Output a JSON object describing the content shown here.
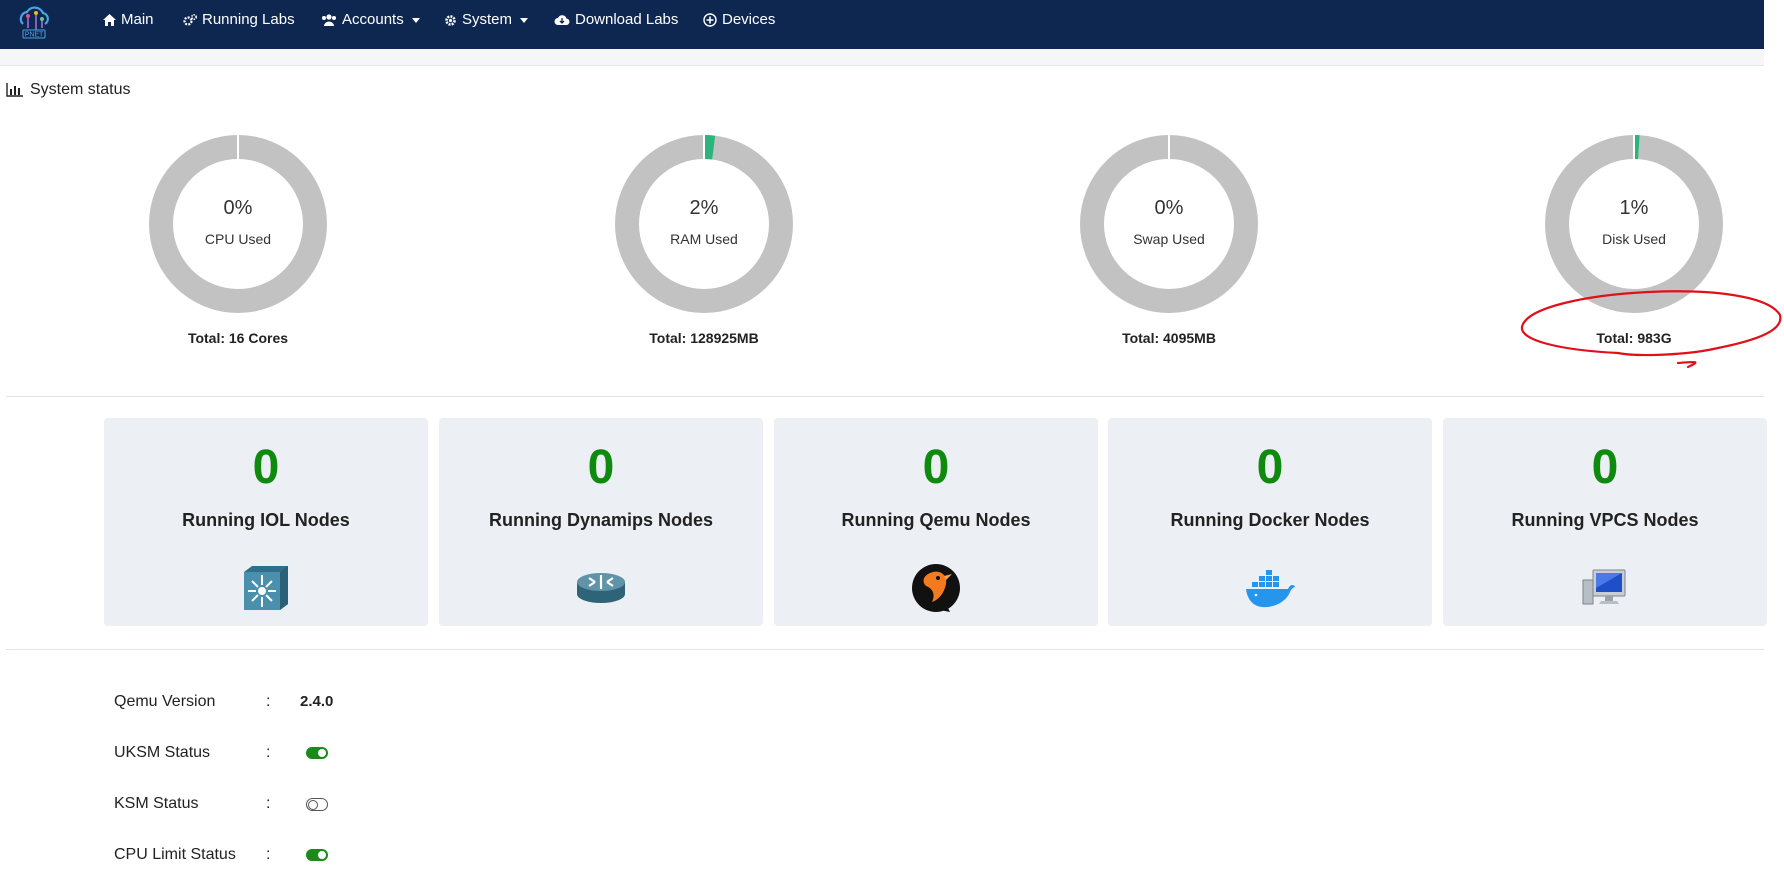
{
  "nav": {
    "logo_text": "PNET",
    "items": [
      {
        "label": "Main",
        "icon": "home-icon"
      },
      {
        "label": "Running Labs",
        "icon": "cogs-icon"
      },
      {
        "label": "Accounts",
        "icon": "users-icon",
        "dropdown": true
      },
      {
        "label": "System",
        "icon": "gear-icon",
        "dropdown": true
      },
      {
        "label": "Download Labs",
        "icon": "cloud-download-icon"
      },
      {
        "label": "Devices",
        "icon": "plus-circle-icon"
      }
    ]
  },
  "system_status": {
    "title": "System status",
    "gauges": [
      {
        "percent_text": "0%",
        "label": "CPU Used",
        "total": "Total: 16 Cores",
        "value": 0
      },
      {
        "percent_text": "2%",
        "label": "RAM Used",
        "total": "Total: 128925MB",
        "value": 2
      },
      {
        "percent_text": "0%",
        "label": "Swap Used",
        "total": "Total: 4095MB",
        "value": 0
      },
      {
        "percent_text": "1%",
        "label": "Disk Used",
        "total": "Total: 983G",
        "value": 1
      }
    ],
    "gauge_colors": {
      "track": "#c2c2c2",
      "fill": "#2bb57c"
    }
  },
  "nodes": [
    {
      "count": "0",
      "label": "Running IOL Nodes",
      "icon": "switch-icon"
    },
    {
      "count": "0",
      "label": "Running Dynamips Nodes",
      "icon": "router-icon"
    },
    {
      "count": "0",
      "label": "Running Qemu Nodes",
      "icon": "qemu-icon"
    },
    {
      "count": "0",
      "label": "Running Docker Nodes",
      "icon": "docker-icon"
    },
    {
      "count": "0",
      "label": "Running VPCS Nodes",
      "icon": "computer-icon"
    }
  ],
  "info": {
    "qemu_version": {
      "label": "Qemu Version",
      "colon": ":",
      "value": "2.4.0"
    },
    "uksm": {
      "label": "UKSM Status",
      "colon": ":",
      "enabled": true
    },
    "ksm": {
      "label": "KSM Status",
      "colon": ":",
      "enabled": false
    },
    "cpu_limit": {
      "label": "CPU Limit Status",
      "colon": ":",
      "enabled": true
    }
  },
  "colors": {
    "navbar": "#0e2750",
    "count_green": "#0e8a0e",
    "annotation_red": "#e0101a"
  }
}
